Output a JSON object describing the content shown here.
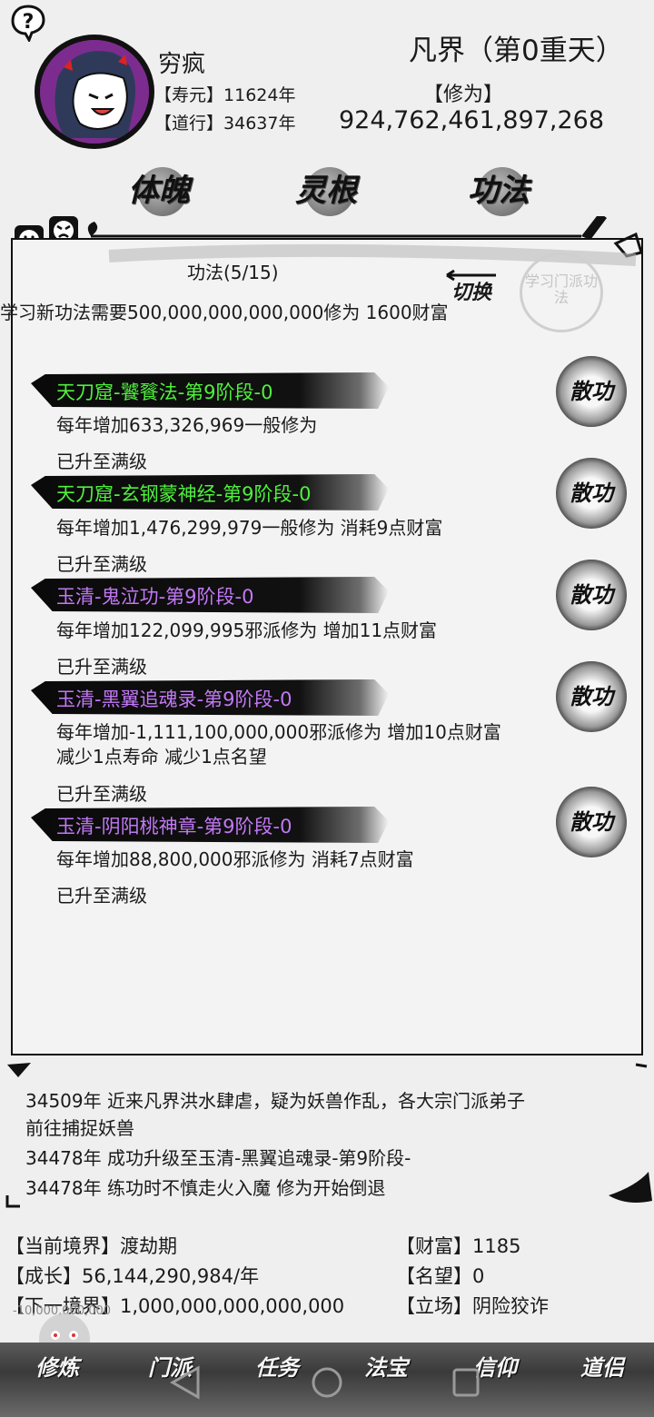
{
  "header": {
    "help_symbol": "?",
    "player_name": "穷疯",
    "lifespan_label": "【寿元】",
    "lifespan_value": "11624年",
    "dao_label": "【道行】",
    "dao_value": "34637年",
    "realm": "凡界（第0重天）",
    "cultivation_label": "【修为】",
    "cultivation_value": "924,762,461,897,268"
  },
  "tabs": [
    {
      "label": "体魄"
    },
    {
      "label": "灵根"
    },
    {
      "label": "功法"
    }
  ],
  "panel": {
    "title": "功法(5/15)",
    "learn_requirement": "学习新功法需要500,000,000,000,000修为 1600财富",
    "switch_label": "切换",
    "learn_sect_label": "学习门派功法"
  },
  "skills": [
    {
      "name": "天刀窟-饕餮法-第9阶段-0",
      "color": "#4ff03d",
      "desc1": "每年增加633,326,969一般修为",
      "desc2": "",
      "status": "已升至满级",
      "action": "散功"
    },
    {
      "name": "天刀窟-玄钢蒙神经-第9阶段-0",
      "color": "#4ff03d",
      "desc1": "每年增加1,476,299,979一般修为 消耗9点财富",
      "desc2": "",
      "status": "已升至满级",
      "action": "散功"
    },
    {
      "name": "玉清-鬼泣功-第9阶段-0",
      "color": "#c278f4",
      "desc1": "每年增加122,099,995邪派修为 增加11点财富",
      "desc2": "",
      "status": "已升至满级",
      "action": "散功"
    },
    {
      "name": "玉清-黑翼追魂录-第9阶段-0",
      "color": "#c278f4",
      "desc1": "每年增加-1,111,100,000,000邪派修为 增加10点财富",
      "desc2": "减少1点寿命 减少1点名望",
      "status": "已升至满级",
      "action": "散功"
    },
    {
      "name": "玉清-阴阳桃神章-第9阶段-0",
      "color": "#c278f4",
      "desc1": "每年增加88,800,000邪派修为 消耗7点财富",
      "desc2": "",
      "status": "已升至满级",
      "action": "散功"
    }
  ],
  "log": [
    "34509年 近来凡界洪水肆虐，疑为妖兽作乱，各大宗门派弟子",
    "前往捕捉妖兽",
    "34478年 成功升级至玉清-黑翼追魂录-第9阶段-",
    "34478年 练功时不慎走火入魔 修为开始倒退"
  ],
  "stats": {
    "realm_label": "【当前境界】",
    "realm_value": "渡劫期",
    "growth_label": "【成长】",
    "growth_value": "56,144,290,984/年",
    "next_label": "【下一境界】",
    "next_value": "1,000,000,000,000,000",
    "wealth_label": "【财富】",
    "wealth_value": "1185",
    "fame_label": "【名望】",
    "fame_value": "0",
    "stance_label": "【立场】",
    "stance_value": "阴险狡诈",
    "overlay_value": "-10,000,000,000"
  },
  "nav": [
    {
      "label": "修炼"
    },
    {
      "label": "门派"
    },
    {
      "label": "任务"
    },
    {
      "label": "法宝"
    },
    {
      "label": "信仰"
    },
    {
      "label": "道侣"
    }
  ],
  "colors": {
    "green_skill": "#4ff03d",
    "purple_skill": "#c278f4",
    "ink": "#111111"
  }
}
